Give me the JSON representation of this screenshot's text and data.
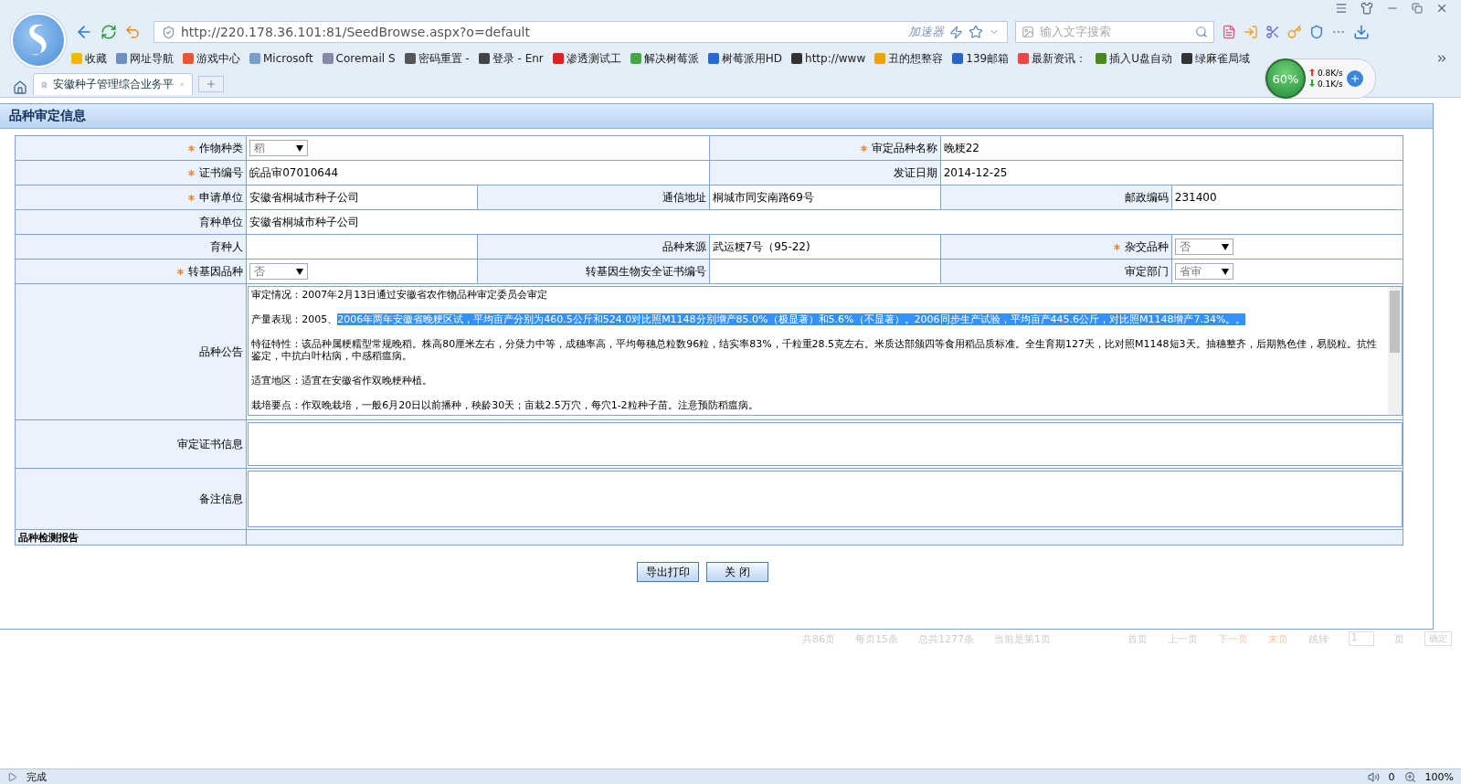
{
  "browser": {
    "address": "http://220.178.36.101:81/SeedBrowse.aspx?o=default",
    "accelerator": "加速器",
    "search_placeholder": "输入文字搜索",
    "bookmarks": [
      "收藏",
      "网址导航",
      "游戏中心",
      "Microsoft",
      "Coremail S",
      "密码重置 -",
      "登录 - Enr",
      "渗透测试工",
      "解决树莓派",
      "树莓派用HD",
      "http://www",
      "丑的想整容",
      "139邮箱",
      "最新资讯：",
      "插入U盘自动",
      "绿麻雀局域"
    ],
    "tabs": [
      {
        "label": "安徽种子管理综合业务平",
        "selected": true
      }
    ],
    "speed": {
      "percent": "60%",
      "up": "0.8K/s",
      "down": "0.1K/s"
    }
  },
  "dialog": {
    "title": "品种审定信息",
    "rows": [
      [
        {
          "kind": "label",
          "text": "作物种类",
          "required": true
        },
        {
          "kind": "select",
          "value": "稻"
        },
        {
          "kind": "label",
          "text": "审定品种名称",
          "required": true
        },
        {
          "kind": "value",
          "text": "晚粳22"
        }
      ],
      [
        {
          "kind": "label",
          "text": "证书编号",
          "required": true
        },
        {
          "kind": "value",
          "text": "皖品审07010644"
        },
        {
          "kind": "label",
          "text": "发证日期",
          "required": false
        },
        {
          "kind": "value",
          "text": "2014-12-25"
        }
      ],
      [
        {
          "kind": "label",
          "text": "申请单位",
          "required": true
        },
        {
          "kind": "value",
          "text": "安徽省桐城市种子公司"
        },
        {
          "kind": "label",
          "text": "通信地址",
          "required": false
        },
        {
          "kind": "value",
          "text": "桐城市同安南路69号"
        },
        {
          "kind": "label",
          "text": "邮政编码",
          "required": false
        },
        {
          "kind": "value",
          "text": "231400"
        }
      ],
      [
        {
          "kind": "label",
          "text": "育种单位",
          "required": false
        },
        {
          "kind": "value",
          "text": "安徽省桐城市种子公司"
        }
      ],
      [
        {
          "kind": "label",
          "text": "育种人",
          "required": false
        },
        {
          "kind": "value",
          "text": ""
        },
        {
          "kind": "label",
          "text": "品种来源",
          "required": false
        },
        {
          "kind": "value",
          "text": "武运粳7号（95-22)"
        },
        {
          "kind": "label",
          "text": "杂交品种",
          "required": true
        },
        {
          "kind": "select",
          "value": "否"
        }
      ],
      [
        {
          "kind": "label",
          "text": "转基因品种",
          "required": true
        },
        {
          "kind": "select",
          "value": "否"
        },
        {
          "kind": "label",
          "text": "转基因生物安全证书编号",
          "required": false
        },
        {
          "kind": "value",
          "text": ""
        },
        {
          "kind": "label",
          "text": "审定部门",
          "required": false
        },
        {
          "kind": "select",
          "value": "省审"
        }
      ]
    ],
    "announcement": {
      "label": "品种公告",
      "paragraphs": [
        [
          {
            "text": "审定情况：2007年2月13日通过安徽省农作物品种审定委员会审定",
            "selected": false
          }
        ],
        [
          {
            "text": "产量表现：2005、",
            "selected": false
          },
          {
            "text": "2006年两年安徽省晚粳区试，平均亩产分别为460.5公斤和524.0对比照M1148分别增产85.0%（极显著）和5.6%（不显著）。2006同步生产试验，平均亩产445.6公斤，对比照M1148增产7.34%。。",
            "selected": true
          }
        ],
        [
          {
            "text": "特征特性：该品种属粳糯型常规晚稻。株高80厘米左右，分蘖力中等，成穗率高，平均每穗总粒数96粒，结实率83%，千粒重28.5克左右。米质达部颁四等食用稻品质标准。全生育期127天，比对照M1148短3天。抽穗整齐，后期熟色佳，易脱粒。抗性鉴定，中抗白叶枯病，中感稻瘟病。",
            "selected": false
          }
        ],
        [
          {
            "text": "适宜地区：适宜在安徽省作双晚粳种植。",
            "selected": false
          }
        ],
        [
          {
            "text": "栽培要点：作双晚栽培，一般6月20日以前播种，秧龄30天；亩栽2.5万穴，每穴1-2粒种子苗。注意预防稻瘟病。",
            "selected": false
          }
        ]
      ]
    },
    "certificate": {
      "label": "审定证书信息"
    },
    "remarks": {
      "label": "备注信息"
    },
    "report": {
      "label": "品种检测报告"
    },
    "buttons": [
      "导出打印",
      "关 闭"
    ]
  },
  "pager": {
    "texts": [
      "共86页",
      "每页15条",
      "总共1277条",
      "当前是第1页"
    ],
    "links": [
      "首页",
      "上一页",
      "下一页",
      "末页"
    ],
    "jump": "跳转",
    "page_value": "1",
    "page_unit": "页",
    "go": "确定"
  },
  "status_bar": {
    "text": "完成",
    "blocked": "0",
    "zoom": "100%"
  }
}
